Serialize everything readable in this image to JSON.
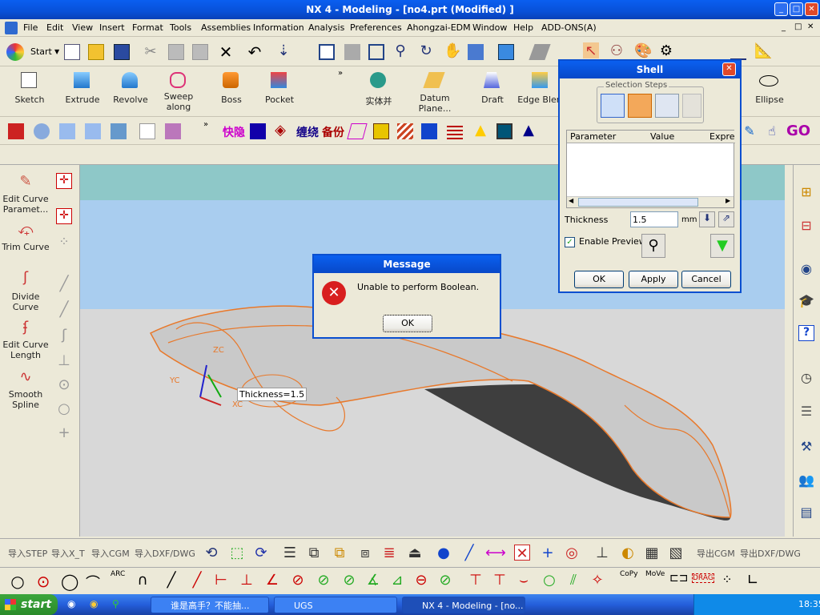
{
  "window": {
    "title": "NX 4 - Modeling - [no4.prt (Modified) ]"
  },
  "menu": [
    "File",
    "Edit",
    "View",
    "Insert",
    "Format",
    "Tools",
    "Assemblies",
    "Information",
    "Analysis",
    "Preferences",
    "Ahongzai-EDM",
    "Window",
    "Help",
    "ADD-ONS(A)"
  ],
  "standard": {
    "start": "Start"
  },
  "feature_tools": [
    {
      "name": "sketch",
      "label": "Sketch"
    },
    {
      "name": "extrude",
      "label": "Extrude"
    },
    {
      "name": "revolve",
      "label": "Revolve"
    },
    {
      "name": "sweep",
      "label": "Sweep\nalong"
    },
    {
      "name": "boss",
      "label": "Boss"
    },
    {
      "name": "pocket",
      "label": "Pocket"
    },
    {
      "name": "unite",
      "label": "实体并"
    },
    {
      "name": "datum",
      "label": "Datum\nPlane..."
    },
    {
      "name": "draft",
      "label": "Draft"
    },
    {
      "name": "edge-blend",
      "label": "Edge Blen"
    },
    {
      "name": "ellipse",
      "label": "Ellipse"
    }
  ],
  "custom_toolbar": {
    "quick": "快隐",
    "wrap": "缠绕",
    "backup": "备份",
    "go": "GO"
  },
  "left_tools": [
    {
      "name": "edit-curve-params",
      "label": "Edit Curve\nParamet..."
    },
    {
      "name": "trim-curve",
      "label": "Trim Curve"
    },
    {
      "name": "divide-curve",
      "label": "Divide\nCurve"
    },
    {
      "name": "edit-curve-length",
      "label": "Edit Curve\nLength"
    },
    {
      "name": "smooth-spline",
      "label": "Smooth\nSpline"
    }
  ],
  "viewport": {
    "thickness_tag": "Thickness=1.5",
    "axes": {
      "zc": "ZC",
      "yc": "YC",
      "xc": "XC"
    }
  },
  "shell": {
    "title": "Shell",
    "steps_label": "Selection Steps",
    "columns": [
      "Parameter",
      "Value",
      "Expres"
    ],
    "thickness_label": "Thickness",
    "thickness_value": "1.5",
    "unit": "mm",
    "preview_label": "Enable Preview",
    "preview_checked": true,
    "ok": "OK",
    "apply": "Apply",
    "cancel": "Cancel"
  },
  "message": {
    "title": "Message",
    "text": "Unable to perform Boolean.",
    "ok": "OK"
  },
  "bottom_left": [
    "导入STEP",
    "导入X_T",
    "导入CGM",
    "导入DXF/DWG"
  ],
  "bottom_right": [
    "导出CGM",
    "导出DXF/DWG"
  ],
  "taskbar": {
    "start": "start",
    "tasks": [
      "谁是高手？不能抽...",
      "UGS",
      "NX 4 - Modeling - [no..."
    ],
    "clock": "18:35"
  },
  "colors": {
    "titlebar": "#0a5ff0",
    "curve": "#e8782a",
    "error": "#d81e1e",
    "sky": "#9fc6ee",
    "teal": "#8ec8c8"
  }
}
